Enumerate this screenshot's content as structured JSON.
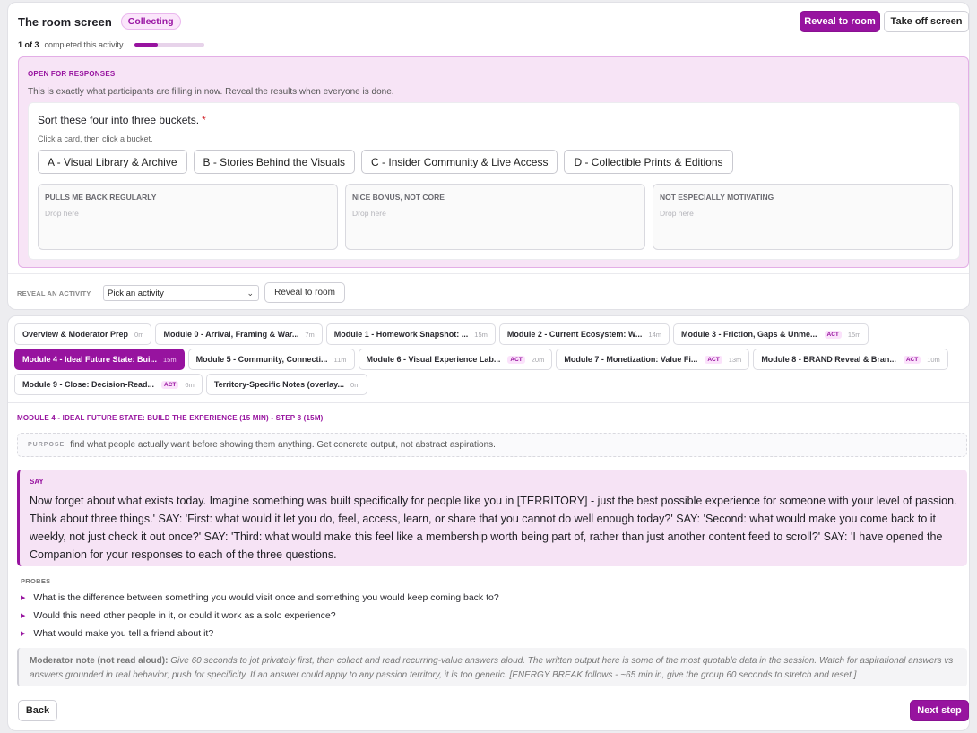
{
  "header": {
    "title": "The room screen",
    "status": "Collecting",
    "reveal_label": "Reveal to room",
    "takeoff_label": "Take off screen"
  },
  "progress": {
    "count": "1 of 3",
    "label": "completed this activity",
    "fraction": 0.333
  },
  "open_panel": {
    "heading": "OPEN FOR RESPONSES",
    "description": "This is exactly what participants are filling in now. Reveal the results when everyone is done.",
    "question": "Sort these four into three buckets.",
    "required_mark": "*",
    "hint": "Click a card, then click a bucket.",
    "options": [
      "A - Visual Library & Archive",
      "B - Stories Behind the Visuals",
      "C - Insider Community & Live Access",
      "D - Collectible Prints & Editions"
    ],
    "buckets": [
      {
        "title": "PULLS ME BACK REGULARLY",
        "placeholder": "Drop here"
      },
      {
        "title": "NICE BONUS, NOT CORE",
        "placeholder": "Drop here"
      },
      {
        "title": "NOT ESPECIALLY MOTIVATING",
        "placeholder": "Drop here"
      }
    ]
  },
  "reveal_activity": {
    "label": "REVEAL AN ACTIVITY",
    "select_value": "Pick an activity",
    "button_label": "Reveal to room"
  },
  "modules": [
    {
      "label": "Overview & Moderator Prep",
      "act": "",
      "duration": "0m",
      "active": false
    },
    {
      "label": "Module 0 - Arrival, Framing & War...",
      "act": "",
      "duration": "7m",
      "active": false
    },
    {
      "label": "Module 1 - Homework Snapshot: ...",
      "act": "",
      "duration": "15m",
      "active": false
    },
    {
      "label": "Module 2 - Current Ecosystem: W...",
      "act": "",
      "duration": "14m",
      "active": false
    },
    {
      "label": "Module 3 - Friction, Gaps & Unme...",
      "act": "ACT",
      "duration": "15m",
      "active": false
    },
    {
      "label": "Module 4 - Ideal Future State: Bui...",
      "act": "",
      "duration": "15m",
      "active": true
    },
    {
      "label": "Module 5 - Community, Connecti...",
      "act": "",
      "duration": "11m",
      "active": false
    },
    {
      "label": "Module 6 - Visual Experience Lab...",
      "act": "ACT",
      "duration": "20m",
      "active": false
    },
    {
      "label": "Module 7 - Monetization: Value Fi...",
      "act": "ACT",
      "duration": "13m",
      "active": false
    },
    {
      "label": "Module 8 - BRAND Reveal & Bran...",
      "act": "ACT",
      "duration": "10m",
      "active": false
    },
    {
      "label": "Module 9 - Close: Decision-Read...",
      "act": "ACT",
      "duration": "6m",
      "active": false
    },
    {
      "label": "Territory-Specific Notes (overlay...",
      "act": "",
      "duration": "0m",
      "active": false
    }
  ],
  "step": {
    "heading": "MODULE 4 - IDEAL FUTURE STATE: BUILD THE EXPERIENCE (15 MIN) - STEP 8 (15M)",
    "purpose_label": "PURPOSE",
    "purpose_text": "find what people actually want before showing them anything. Get concrete output, not abstract aspirations.",
    "say_label": "SAY",
    "say_text": "Now forget about what exists today. Imagine something was built specifically for people like you in [TERRITORY] - just the best possible experience for someone with your level of passion. Think about three things.' SAY: 'First: what would it let you do, feel, access, learn, or share that you cannot do well enough today?' SAY: 'Second: what would make you come back to it weekly, not just check it out once?' SAY: 'Third: what would make this feel like a membership worth being part of, rather than just another content feed to scroll?' SAY: 'I have opened the Companion for your responses to each of the three questions.",
    "probes_label": "PROBES",
    "probes": [
      "What is the difference between something you would visit once and something you would keep coming back to?",
      "Would this need other people in it, or could it work as a solo experience?",
      "What would make you tell a friend about it?"
    ],
    "note_label": "Moderator note (not read aloud):",
    "note_text": "Give 60 seconds to jot privately first, then collect and read recurring-value answers aloud. The written output here is some of the most quotable data in the session. Watch for aspirational answers vs answers grounded in real behavior; push for specificity. If an answer could apply to any passion territory, it is too generic. [ENERGY BREAK follows - ~65 min in, give the group 60 seconds to stretch and reset.]"
  },
  "footer": {
    "back_label": "Back",
    "next_label": "Next step"
  },
  "colors": {
    "accent": "#97139f",
    "accent_light": "#f6e3f5"
  }
}
